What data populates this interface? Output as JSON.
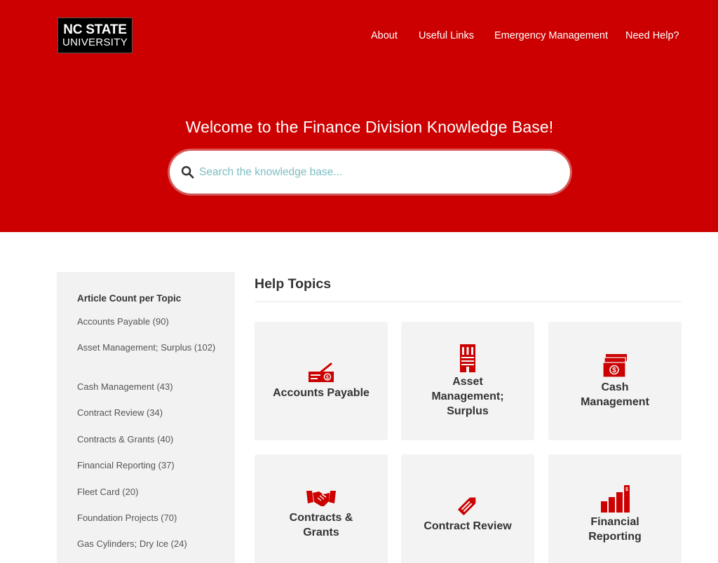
{
  "header": {
    "logo_line1": "NC STATE",
    "logo_line2": "UNIVERSITY",
    "nav": [
      {
        "label": "About"
      },
      {
        "label": "Useful Links"
      },
      {
        "label": "Emergency Management"
      },
      {
        "label": "Need Help?"
      }
    ]
  },
  "hero": {
    "welcome": "Welcome to the Finance Division Knowledge Base!",
    "search_placeholder": "Search the knowledge base...",
    "search_icon": "search-icon"
  },
  "sidebar": {
    "title": "Article Count per Topic",
    "items": [
      {
        "label": "Accounts Payable (90)"
      },
      {
        "label": "Asset Management; Surplus (102)"
      },
      {
        "label": "Cash Management (43)"
      },
      {
        "label": "Contract Review (34)"
      },
      {
        "label": "Contracts & Grants (40)"
      },
      {
        "label": "Financial Reporting (37)"
      },
      {
        "label": "Fleet Card (20)"
      },
      {
        "label": "Foundation Projects (70)"
      },
      {
        "label": "Gas Cylinders; Dry Ice (24)"
      }
    ]
  },
  "main": {
    "heading": "Help Topics",
    "topics": [
      {
        "label": "Accounts Payable",
        "icon": "check-payment-icon"
      },
      {
        "label": "Asset Management; Surplus",
        "icon": "building-icon"
      },
      {
        "label": "Cash Management",
        "icon": "cash-stack-icon"
      },
      {
        "label": "Contracts & Grants",
        "icon": "handshake-icon"
      },
      {
        "label": "Contract Review",
        "icon": "pencil-icon"
      },
      {
        "label": "Financial Reporting",
        "icon": "bar-chart-icon"
      }
    ]
  },
  "colors": {
    "brand_red": "#cc0000",
    "icon_red": "#cc0000",
    "card_bg": "#f3f3f3",
    "sidebar_bg": "#f2f2f2",
    "placeholder": "#7dbdc4"
  }
}
